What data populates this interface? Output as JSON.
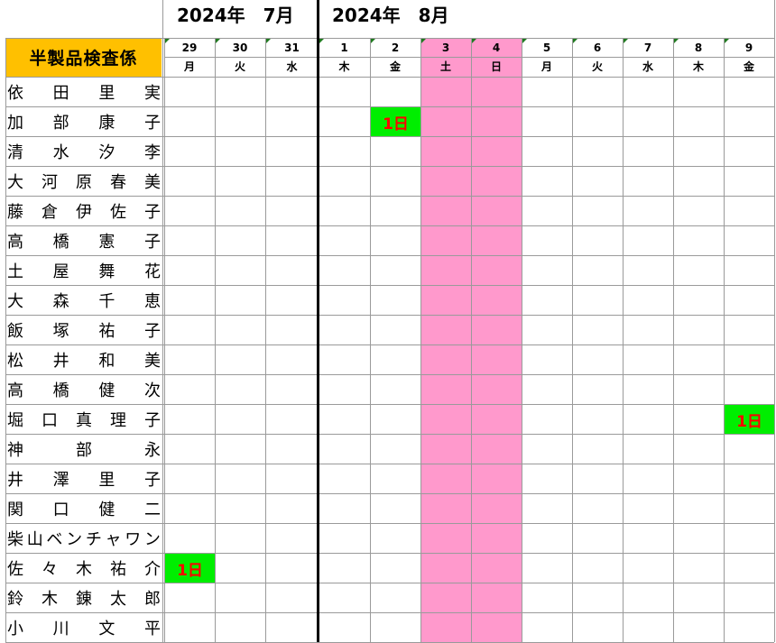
{
  "months": [
    {
      "label": "2024年　7月"
    },
    {
      "label": "2024年　8月"
    }
  ],
  "department": "半製品検査係",
  "days": [
    {
      "num": "29",
      "wd": "月",
      "weekend": false
    },
    {
      "num": "30",
      "wd": "火",
      "weekend": false
    },
    {
      "num": "31",
      "wd": "水",
      "weekend": false
    },
    {
      "num": "1",
      "wd": "木",
      "weekend": false
    },
    {
      "num": "2",
      "wd": "金",
      "weekend": false
    },
    {
      "num": "3",
      "wd": "土",
      "weekend": true
    },
    {
      "num": "4",
      "wd": "日",
      "weekend": true
    },
    {
      "num": "5",
      "wd": "月",
      "weekend": false
    },
    {
      "num": "6",
      "wd": "火",
      "weekend": false
    },
    {
      "num": "7",
      "wd": "水",
      "weekend": false
    },
    {
      "num": "8",
      "wd": "木",
      "weekend": false
    },
    {
      "num": "9",
      "wd": "金",
      "weekend": false
    }
  ],
  "staff": [
    {
      "name": "依田里実",
      "chars": [
        "依",
        "田",
        "里",
        "実"
      ],
      "leave": []
    },
    {
      "name": "加部康子",
      "chars": [
        "加",
        "部",
        "康",
        "子"
      ],
      "leave": [
        {
          "day": "2",
          "label": "1日"
        }
      ]
    },
    {
      "name": "清水汐李",
      "chars": [
        "清",
        "水",
        "汐",
        "李"
      ],
      "leave": []
    },
    {
      "name": "大河原春美",
      "chars": [
        "大",
        "河",
        "原",
        "春",
        "美"
      ],
      "leave": []
    },
    {
      "name": "藤倉伊佐子",
      "chars": [
        "藤",
        "倉",
        "伊",
        "佐",
        "子"
      ],
      "leave": []
    },
    {
      "name": "高橋憲子",
      "chars": [
        "高",
        "橋",
        "憲",
        "子"
      ],
      "leave": []
    },
    {
      "name": "土屋舞花",
      "chars": [
        "土",
        "屋",
        "舞",
        "花"
      ],
      "leave": []
    },
    {
      "name": "大森千恵",
      "chars": [
        "大",
        "森",
        "千",
        "恵"
      ],
      "leave": []
    },
    {
      "name": "飯塚祐子",
      "chars": [
        "飯",
        "塚",
        "祐",
        "子"
      ],
      "leave": []
    },
    {
      "name": "松井和美",
      "chars": [
        "松",
        "井",
        "和",
        "美"
      ],
      "leave": []
    },
    {
      "name": "高橋健次",
      "chars": [
        "高",
        "橋",
        "健",
        "次"
      ],
      "leave": []
    },
    {
      "name": "堀口真理子",
      "chars": [
        "堀",
        "口",
        "真",
        "理",
        "子"
      ],
      "leave": [
        {
          "day": "9",
          "label": "1日"
        }
      ]
    },
    {
      "name": "神部永",
      "chars": [
        "神",
        "部",
        "永"
      ],
      "leave": []
    },
    {
      "name": "井澤里子",
      "chars": [
        "井",
        "澤",
        "里",
        "子"
      ],
      "leave": []
    },
    {
      "name": "関口健二",
      "chars": [
        "関",
        "口",
        "健",
        "二"
      ],
      "leave": []
    },
    {
      "name": "柴山ベンチャワン",
      "chars": [
        "柴",
        "山",
        "ベ",
        "ン",
        "チ",
        "ャ",
        "ワ",
        "ン"
      ],
      "leave": []
    },
    {
      "name": "佐々木祐介",
      "chars": [
        "佐",
        "々",
        "木",
        "祐",
        "介"
      ],
      "leave": [
        {
          "day": "29",
          "label": "1日"
        }
      ]
    },
    {
      "name": "鈴木錬太郎",
      "chars": [
        "鈴",
        "木",
        "錬",
        "太",
        "郎"
      ],
      "leave": []
    },
    {
      "name": "小川文平",
      "chars": [
        "小",
        "川",
        "文",
        "平"
      ],
      "leave": []
    }
  ],
  "colors": {
    "department_bg": "#ffc000",
    "weekend": "#ff99cc",
    "leave_bg": "#00ee00",
    "leave_text": "#ff0000"
  }
}
